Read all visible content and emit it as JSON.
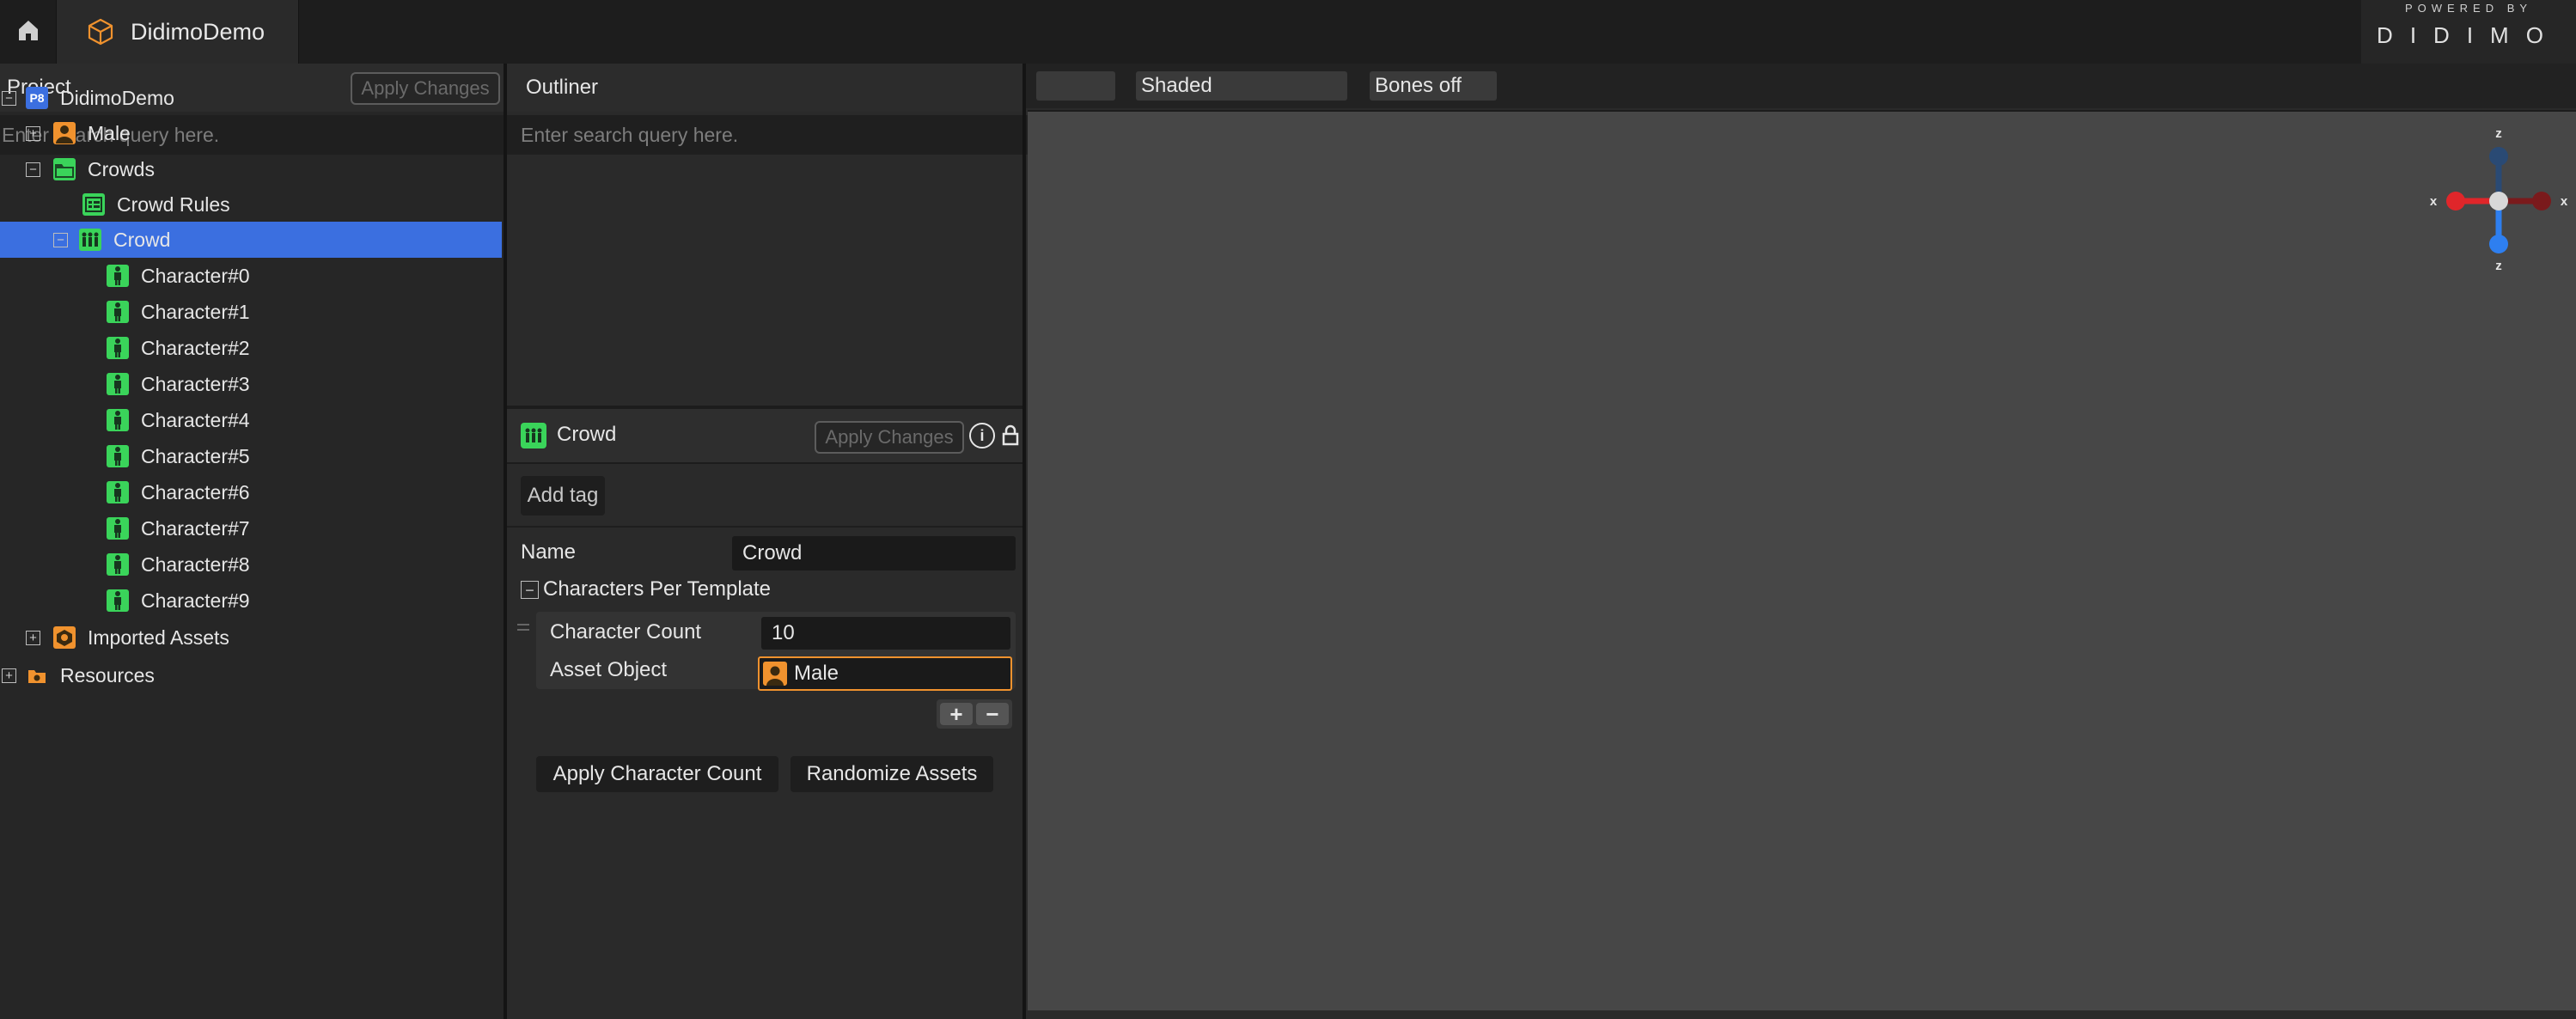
{
  "app": {
    "project_tab": "DidimoDemo",
    "brand_small": "POWERED BY",
    "brand_name": "DIDIMO"
  },
  "project_panel": {
    "title": "Project",
    "apply_changes": "Apply Changes",
    "search_placeholder": "Enter search query here.",
    "tree": [
      {
        "label": "DidimoDemo",
        "icon": "project-icon"
      },
      {
        "label": "Male",
        "icon": "character-asset-icon"
      },
      {
        "label": "Crowds",
        "icon": "folder-icon"
      },
      {
        "label": "Crowd Rules",
        "icon": "rules-icon"
      },
      {
        "label": "Crowd",
        "icon": "crowd-icon"
      },
      {
        "label": "Character#0",
        "icon": "character-icon"
      },
      {
        "label": "Character#1",
        "icon": "character-icon"
      },
      {
        "label": "Character#2",
        "icon": "character-icon"
      },
      {
        "label": "Character#3",
        "icon": "character-icon"
      },
      {
        "label": "Character#4",
        "icon": "character-icon"
      },
      {
        "label": "Character#5",
        "icon": "character-icon"
      },
      {
        "label": "Character#6",
        "icon": "character-icon"
      },
      {
        "label": "Character#7",
        "icon": "character-icon"
      },
      {
        "label": "Character#8",
        "icon": "character-icon"
      },
      {
        "label": "Character#9",
        "icon": "character-icon"
      },
      {
        "label": "Imported Assets",
        "icon": "imported-assets-icon"
      },
      {
        "label": "Resources",
        "icon": "resources-icon"
      }
    ],
    "project_badge": "P8"
  },
  "outliner": {
    "title": "Outliner",
    "search_placeholder": "Enter search query here."
  },
  "inspector": {
    "title": "Crowd",
    "apply_changes": "Apply Changes",
    "add_tag": "Add tag",
    "name_label": "Name",
    "name_value": "Crowd",
    "section": "Characters Per Template",
    "character_count_label": "Character Count",
    "character_count_value": "10",
    "asset_object_label": "Asset Object",
    "asset_object_value": "Male",
    "apply_character_count": "Apply Character Count",
    "randomize_assets": "Randomize Assets"
  },
  "viewport": {
    "shading": "Shaded",
    "bones": "Bones off",
    "gizmo": {
      "top": "z",
      "bottom": "z",
      "left": "x",
      "right": "x"
    }
  },
  "colors": {
    "selection": "#3b6fe0",
    "green": "#3ad45a",
    "orange": "#f0922e",
    "x_axis": "#e0262a",
    "z_axis": "#2e7ff0"
  }
}
